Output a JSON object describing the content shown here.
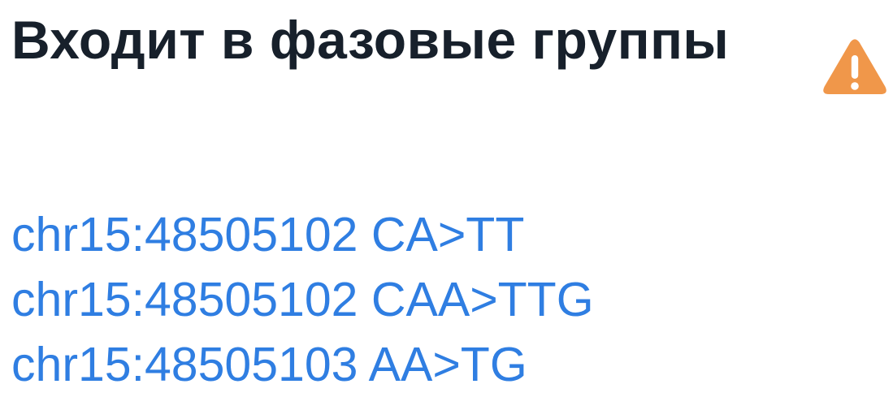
{
  "section": {
    "title": "Входит в фазовые группы",
    "warning_icon": "warning-triangle-icon",
    "warning_color": "#f0974a"
  },
  "phase_groups": [
    {
      "label": "chr15:48505102 CA>TT"
    },
    {
      "label": "chr15:48505102 CAA>TTG"
    },
    {
      "label": "chr15:48505103 AA>TG"
    }
  ],
  "colors": {
    "title": "#17202b",
    "link": "#2f7ee2"
  }
}
